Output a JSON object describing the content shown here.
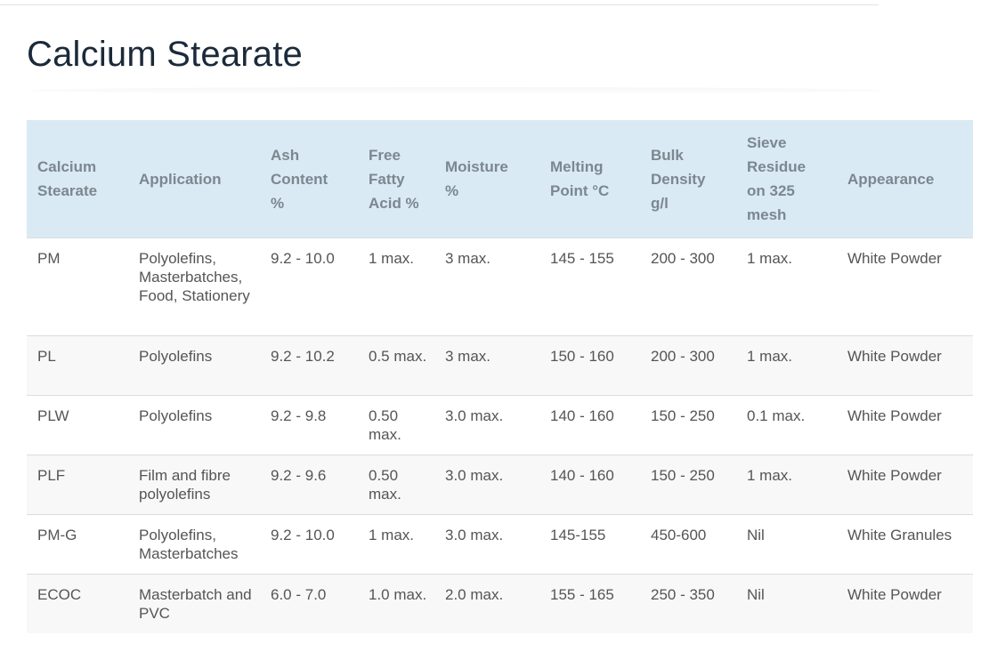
{
  "page": {
    "title": "Calcium Stearate"
  },
  "table": {
    "headers": [
      "Calcium Stearate",
      "Application",
      "Ash Content %",
      "Free Fatty Acid %",
      "Moisture %",
      "Melting Point °C",
      "Bulk Density g/l",
      "Sieve Residue on 325 mesh",
      "Appearance"
    ],
    "rows": [
      [
        "PM",
        "Polyolefins, Masterbatches, Food, Stationery",
        "9.2 - 10.0",
        "1 max.",
        "3 max.",
        "145 - 155",
        "200 - 300",
        "1 max.",
        "White Powder"
      ],
      [
        "PL",
        "Polyolefins",
        "9.2 - 10.2",
        "0.5 max.",
        "3 max.",
        "150 - 160",
        "200 - 300",
        "1 max.",
        "White Powder"
      ],
      [
        "PLW",
        "Polyolefins",
        "9.2 - 9.8",
        "0.50 max.",
        "3.0 max.",
        "140 - 160",
        "150 - 250",
        "0.1 max.",
        "White Powder"
      ],
      [
        "PLF",
        "Film and fibre polyolefins",
        "9.2 - 9.6",
        "0.50 max.",
        "3.0 max.",
        "140 - 160",
        "150 - 250",
        "1 max.",
        "White Powder"
      ],
      [
        "PM-G",
        "Polyolefins, Masterbatches",
        "9.2 - 10.0",
        "1 max.",
        "3.0 max.",
        "145-155",
        "450-600",
        "Nil",
        "White Granules"
      ],
      [
        "ECOC",
        "Masterbatch and PVC",
        "6.0 - 7.0",
        "1.0 max.",
        "2.0 max.",
        "155 - 165",
        "250 - 350",
        "Nil",
        "White Powder"
      ]
    ]
  }
}
